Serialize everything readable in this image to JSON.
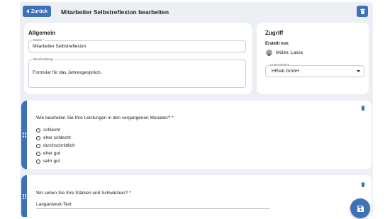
{
  "header": {
    "back_label": "Zurück",
    "title": "Mitarbeiter Selbstreflexion bearbeiten"
  },
  "general": {
    "title": "Allgemein",
    "name_label": "Name *",
    "name_value": "Mitarbeiter Selbstreflexion",
    "description_label": "Beschreibung",
    "description_value": "Formular für das Jahresgespräch."
  },
  "access": {
    "title": "Zugriff",
    "created_by_label": "Erstellt von",
    "creator_name": "Müller, Lasse",
    "company_label": "Unternehmen",
    "company_value": "HRlab GmbH"
  },
  "questions": [
    {
      "text": "Wie beurteilen Sie Ihre Leistungen in den vergangenen Monaten? *",
      "options": [
        "schlecht",
        "eher schlecht",
        "durchschnittlich",
        "eher gut",
        "sehr gut"
      ]
    },
    {
      "text": "Wo sehen Sie Ihre Stärken und Schwächen? *",
      "answer_placeholder": "Langantwort-Text"
    }
  ],
  "colors": {
    "accent": "#3d71b8",
    "background": "#eceff3"
  },
  "icons": {
    "back": "arrow-left-icon",
    "delete": "trash-icon",
    "save": "save-icon",
    "drag": "drag-handle-icon",
    "dropdown": "chevron-down-icon"
  }
}
